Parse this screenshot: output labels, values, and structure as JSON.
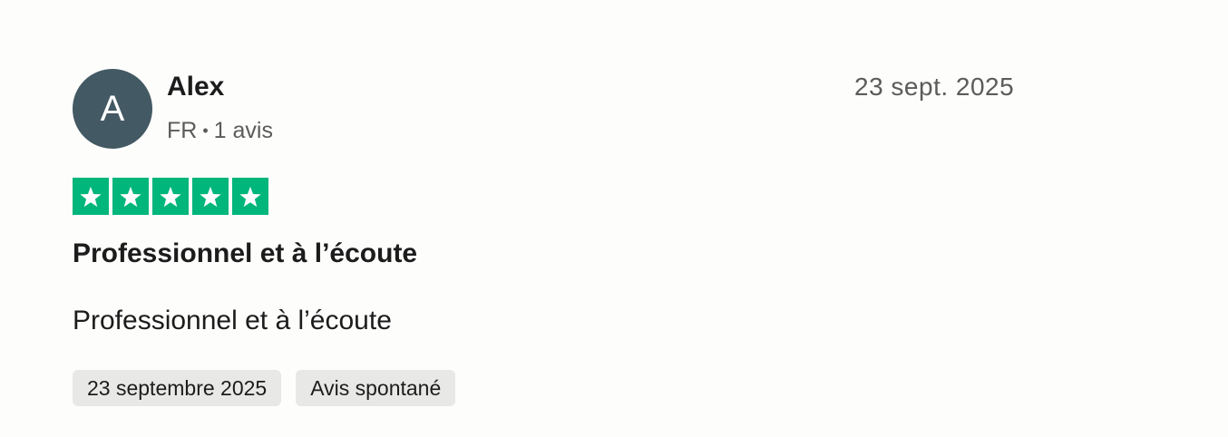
{
  "reviewer": {
    "avatar_initial": "A",
    "name": "Alex",
    "country": "FR",
    "separator": "•",
    "review_count": "1 avis"
  },
  "review": {
    "date": "23 sept. 2025",
    "rating": 5,
    "rating_max": 5,
    "star_color": "#00b67a",
    "title": "Professionnel et à l’écoute",
    "body": "Professionnel et à l’écoute",
    "tags": [
      {
        "label": "23 septembre 2025"
      },
      {
        "label": "Avis spontané"
      }
    ]
  },
  "colors": {
    "avatar_bg": "#435963",
    "star_green": "#00b67a",
    "tag_bg": "#e8e8e6"
  }
}
